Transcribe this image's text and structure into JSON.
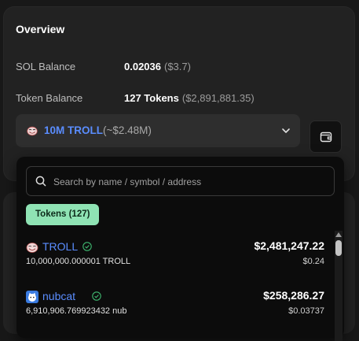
{
  "overview": {
    "title": "Overview",
    "sol_balance_label": "SOL Balance",
    "sol_balance_value": "0.02036",
    "sol_balance_usd": "($3.7)",
    "token_balance_label": "Token Balance",
    "token_balance_value": "127 Tokens",
    "token_balance_usd": "($2,891,881.35)"
  },
  "selector": {
    "selected_label": "10M TROLL",
    "selected_usd": "(~$2.48M)",
    "icon": "troll-face-icon"
  },
  "dropdown": {
    "search_placeholder": "Search by name / symbol / address",
    "tab_label": "Tokens (127)",
    "tokens": [
      {
        "name": "TROLL",
        "amount": "10,000,000.000001 TROLL",
        "usd": "$2,481,247.22",
        "price": "$0.24",
        "icon": "troll-face-icon",
        "verified": true
      },
      {
        "name": "nubcat",
        "amount": "6,910,906.769923432 nub",
        "usd": "$258,286.27",
        "price": "$0.03737",
        "icon": "nubcat-icon",
        "verified": true
      }
    ]
  },
  "colors": {
    "accent_blue": "#5a8dff",
    "pill_green": "#8fe3b4",
    "verified_green": "#3fb870"
  }
}
